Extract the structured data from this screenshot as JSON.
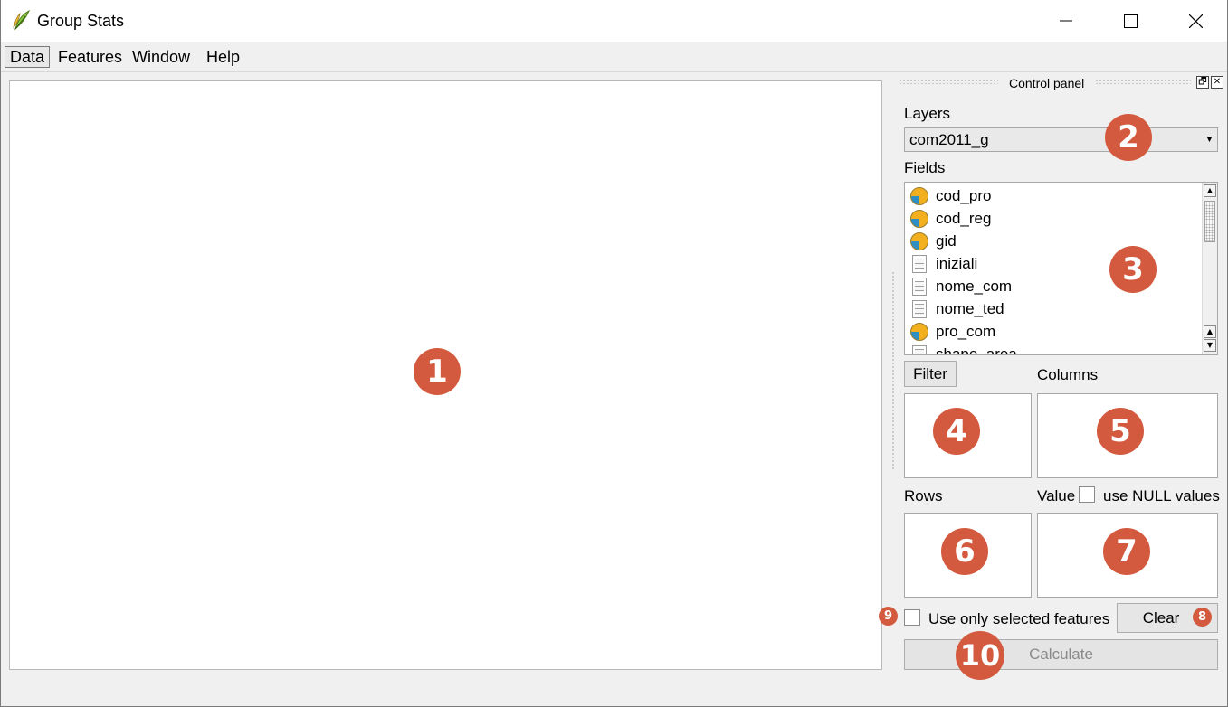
{
  "window": {
    "title": "Group Stats",
    "minimize_glyph": "—",
    "maximize_glyph": "☐",
    "close_glyph": "✕"
  },
  "menu": [
    "Data",
    "Features",
    "Window",
    "Help"
  ],
  "dock": {
    "title": "Control panel",
    "float_glyph": "🗗",
    "close_glyph": "✕"
  },
  "layers": {
    "label": "Layers",
    "selected": "com2011_g"
  },
  "fields": {
    "label": "Fields",
    "items": [
      {
        "name": "cod_pro",
        "icon": "numeric-field-icon"
      },
      {
        "name": "cod_reg",
        "icon": "numeric-field-icon"
      },
      {
        "name": "gid",
        "icon": "numeric-field-icon"
      },
      {
        "name": "iniziali",
        "icon": "text-field-icon"
      },
      {
        "name": "nome_com",
        "icon": "text-field-icon"
      },
      {
        "name": "nome_ted",
        "icon": "text-field-icon"
      },
      {
        "name": "pro_com",
        "icon": "numeric-field-icon"
      },
      {
        "name": "shape_area",
        "icon": "text-field-icon"
      }
    ]
  },
  "filter_button": "Filter",
  "columns_label": "Columns",
  "rows_label": "Rows",
  "value_label": "Value",
  "use_null_label": "use NULL values",
  "use_null_checked": false,
  "use_selected_label": "Use only selected features",
  "use_selected_checked": false,
  "clear_button": "Clear",
  "calculate_button": "Calculate",
  "annotations": [
    "1",
    "2",
    "3",
    "4",
    "5",
    "6",
    "7",
    "8",
    "9",
    "10"
  ],
  "colors": {
    "badge": "#d35a3e",
    "background": "#f0f0f0"
  }
}
